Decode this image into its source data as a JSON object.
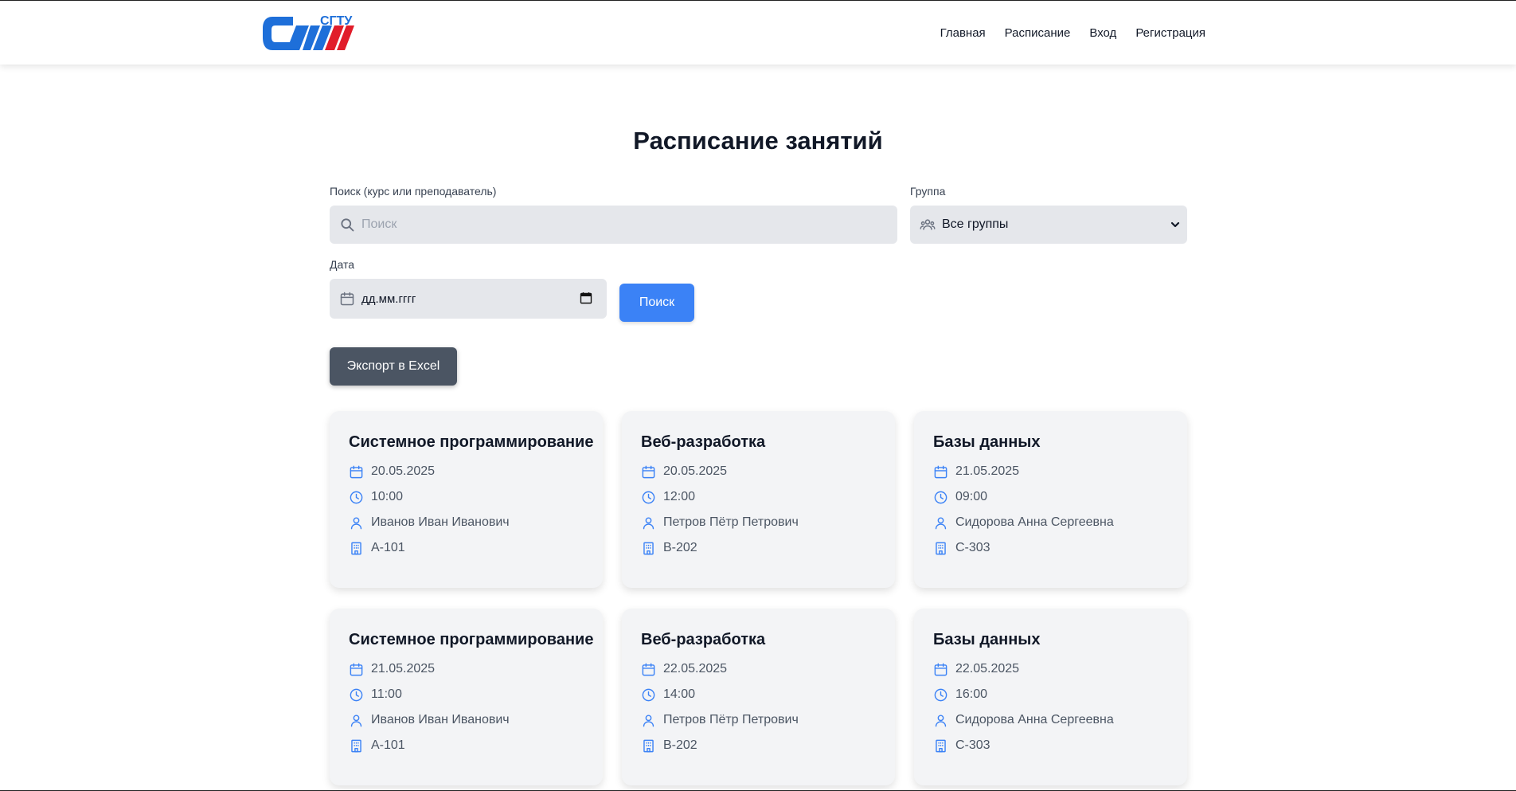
{
  "header": {
    "logo_text": "СГТУ",
    "nav": [
      "Главная",
      "Расписание",
      "Вход",
      "Регистрация"
    ]
  },
  "page": {
    "title": "Расписание занятий"
  },
  "filters": {
    "search_label": "Поиск (курс или преподаватель)",
    "search_placeholder": "Поиск",
    "group_label": "Группа",
    "group_value": "Все группы",
    "date_label": "Дата",
    "date_placeholder": "дд.мм.гггг",
    "search_button": "Поиск",
    "export_button": "Экспорт в Excel"
  },
  "cards": [
    {
      "title": "Системное программирование",
      "date": "20.05.2025",
      "time": "10:00",
      "teacher": "Иванов Иван Иванович",
      "room": "A-101"
    },
    {
      "title": "Веб-разработка",
      "date": "20.05.2025",
      "time": "12:00",
      "teacher": "Петров Пётр Петрович",
      "room": "B-202"
    },
    {
      "title": "Базы данных",
      "date": "21.05.2025",
      "time": "09:00",
      "teacher": "Сидорова Анна Сергеевна",
      "room": "C-303"
    },
    {
      "title": "Системное программирование",
      "date": "21.05.2025",
      "time": "11:00",
      "teacher": "Иванов Иван Иванович",
      "room": "A-101"
    },
    {
      "title": "Веб-разработка",
      "date": "22.05.2025",
      "time": "14:00",
      "teacher": "Петров Пётр Петрович",
      "room": "B-202"
    },
    {
      "title": "Базы данных",
      "date": "22.05.2025",
      "time": "16:00",
      "teacher": "Сидорова Анна Сергеевна",
      "room": "C-303"
    }
  ],
  "colors": {
    "accent": "#3b82f6",
    "export": "#4b5563",
    "logo_blue": "#1e6fd9",
    "logo_red": "#e11d2a"
  }
}
